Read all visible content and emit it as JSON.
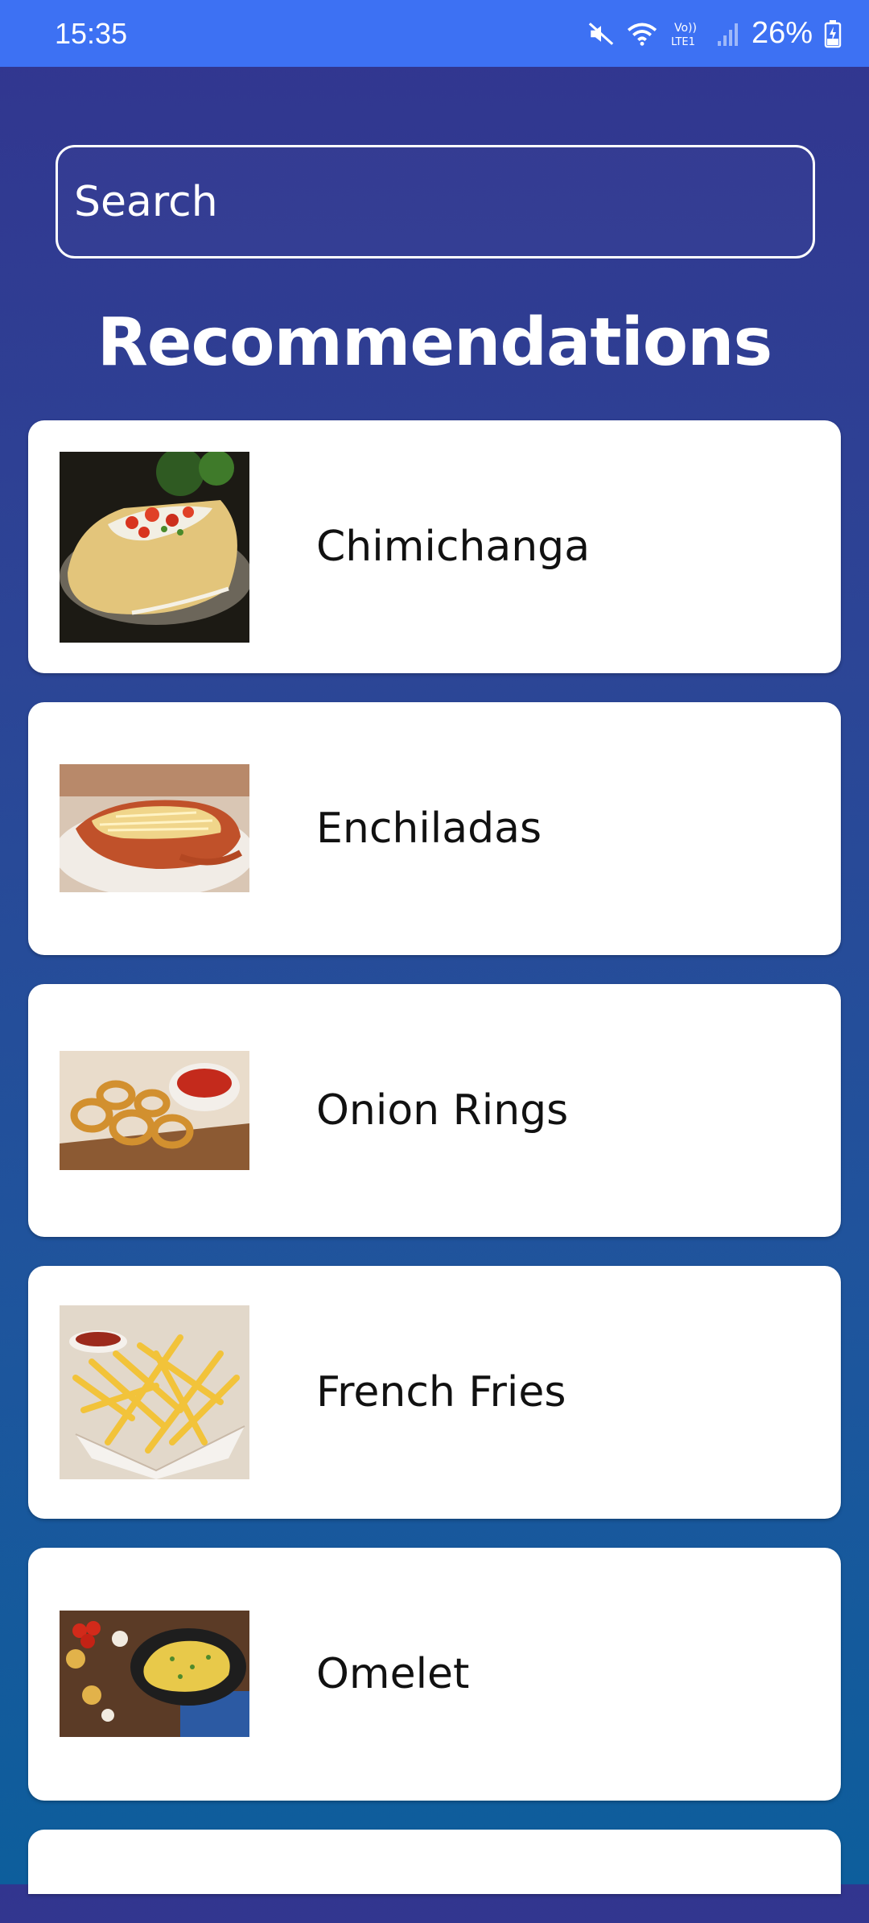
{
  "status_bar": {
    "time": "15:35",
    "battery": "26%",
    "icons": [
      "mute-icon",
      "wifi-icon",
      "volte-lte-icon",
      "signal-icon",
      "battery-charging-icon"
    ]
  },
  "search": {
    "placeholder": "Search"
  },
  "title": "Recommendations",
  "items": [
    {
      "label": "Chimichanga"
    },
    {
      "label": "Enchiladas"
    },
    {
      "label": "Onion Rings"
    },
    {
      "label": "French Fries"
    },
    {
      "label": "Omelet"
    }
  ],
  "colors": {
    "status_bar": "#3d71f3",
    "background_top": "#32358f",
    "background_bottom": "#0d5e9c",
    "card": "#ffffff"
  }
}
